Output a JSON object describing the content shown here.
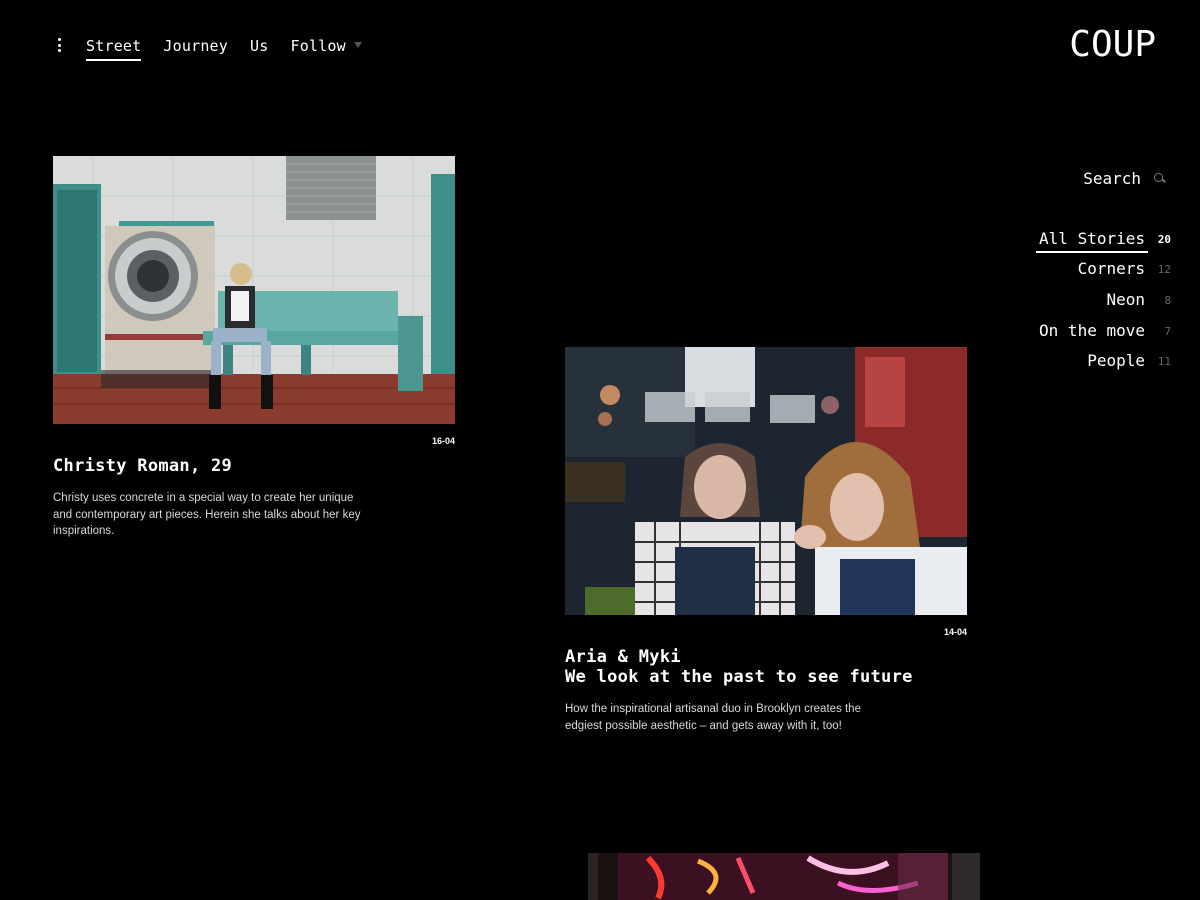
{
  "brand": {
    "logo": "COUP"
  },
  "nav": {
    "items": [
      {
        "label": "Street",
        "active": true
      },
      {
        "label": "Journey"
      },
      {
        "label": "Us"
      },
      {
        "label": "Follow",
        "has_dropdown": true
      }
    ]
  },
  "sidebar": {
    "search_label": "Search",
    "categories": [
      {
        "label": "All Stories",
        "count": "20",
        "active": true
      },
      {
        "label": "Corners",
        "count": "12"
      },
      {
        "label": "Neon",
        "count": "8"
      },
      {
        "label": "On the move",
        "count": "7"
      },
      {
        "label": "People",
        "count": "11"
      }
    ]
  },
  "articles": [
    {
      "date": "16-04",
      "title": "Christy Roman, 29",
      "description": "Christy uses concrete in a special way to create her unique and contemporary art pieces. Herein she talks about her key inspirations."
    },
    {
      "date": "14-04",
      "title_line1": "Aria & Myki",
      "title_line2": "We look at the past to see future",
      "description": "How the inspirational artisanal duo in Brooklyn creates the edgiest possible aesthetic – and gets away with it, too!"
    }
  ],
  "colors": {
    "background": "#000000",
    "text": "#ffffff",
    "muted": "#666666"
  }
}
